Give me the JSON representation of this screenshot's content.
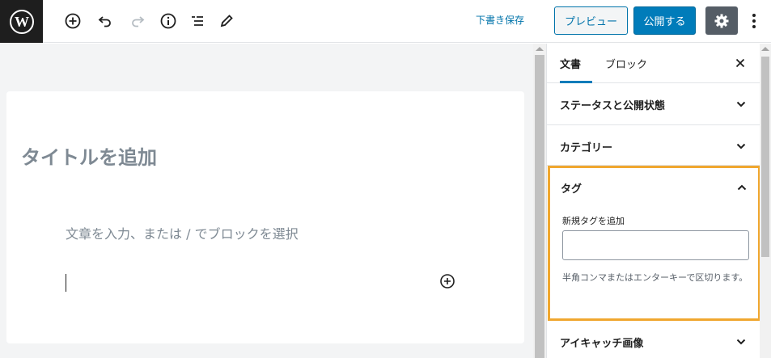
{
  "toolbar": {
    "save_draft": "下書き保存",
    "preview": "プレビュー",
    "publish": "公開する"
  },
  "editor": {
    "title_placeholder": "タイトルを追加",
    "paragraph_placeholder": "文章を入力、または / でブロックを選択"
  },
  "sidebar": {
    "tabs": [
      {
        "label": "文書",
        "active": true
      },
      {
        "label": "ブロック",
        "active": false
      }
    ],
    "panels": {
      "status": {
        "title": "ステータスと公開状態",
        "expanded": false
      },
      "categories": {
        "title": "カテゴリー",
        "expanded": false
      },
      "tags": {
        "title": "タグ",
        "expanded": true,
        "input_label": "新規タグを追加",
        "input_value": "",
        "help": "半角コンマまたはエンターキーで区切ります。"
      },
      "featured_image": {
        "title": "アイキャッチ画像",
        "expanded": false
      }
    }
  },
  "colors": {
    "accent": "#007cba",
    "highlight": "#f0a72f",
    "logo_bg": "#1e1e1e",
    "settings_bg": "#555d66"
  }
}
